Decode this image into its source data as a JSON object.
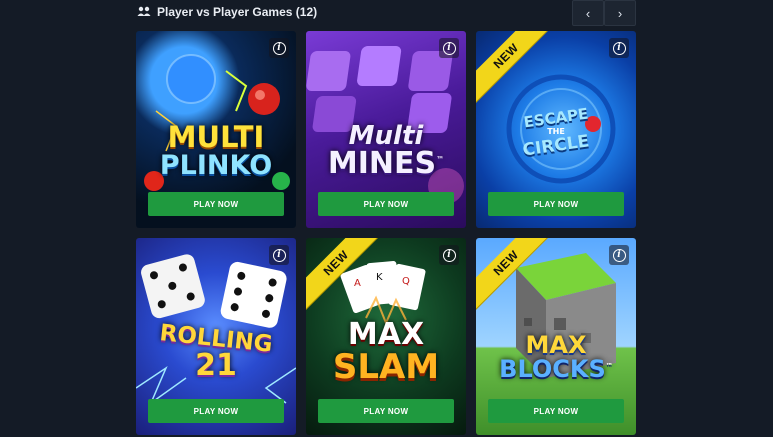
{
  "section": {
    "title": "Player vs Player Games (12)",
    "prev_glyph": "‹",
    "next_glyph": "›"
  },
  "games": [
    {
      "logo_line1": "MULTI",
      "logo_line2": "PLINKO",
      "play_label": "PLAY NOW",
      "info_glyph": "i",
      "is_new": false
    },
    {
      "logo_line1": "Multi",
      "logo_line2": "MINES",
      "logo_tm": "™",
      "play_label": "PLAY NOW",
      "info_glyph": "i",
      "is_new": false
    },
    {
      "logo_line1": "ESCAPE",
      "logo_line2": "THE",
      "logo_line3": "CIRCLE",
      "play_label": "PLAY NOW",
      "info_glyph": "i",
      "is_new": true,
      "badge": "NEW"
    },
    {
      "logo_line1": "ROLLING",
      "logo_line2": "21",
      "play_label": "PLAY NOW",
      "info_glyph": "i",
      "is_new": false
    },
    {
      "logo_line1": "MAX",
      "logo_line2": "SLAM",
      "play_label": "PLAY NOW",
      "info_glyph": "i",
      "is_new": true,
      "badge": "NEW"
    },
    {
      "logo_line1": "MAX",
      "logo_line2": "BLOCKS",
      "logo_tm": "™",
      "play_label": "PLAY NOW",
      "info_glyph": "i",
      "is_new": true,
      "badge": "NEW"
    }
  ],
  "colors": {
    "background": "#141b26",
    "play_button": "#1f9a3f",
    "new_ribbon": "#f2d61a"
  }
}
